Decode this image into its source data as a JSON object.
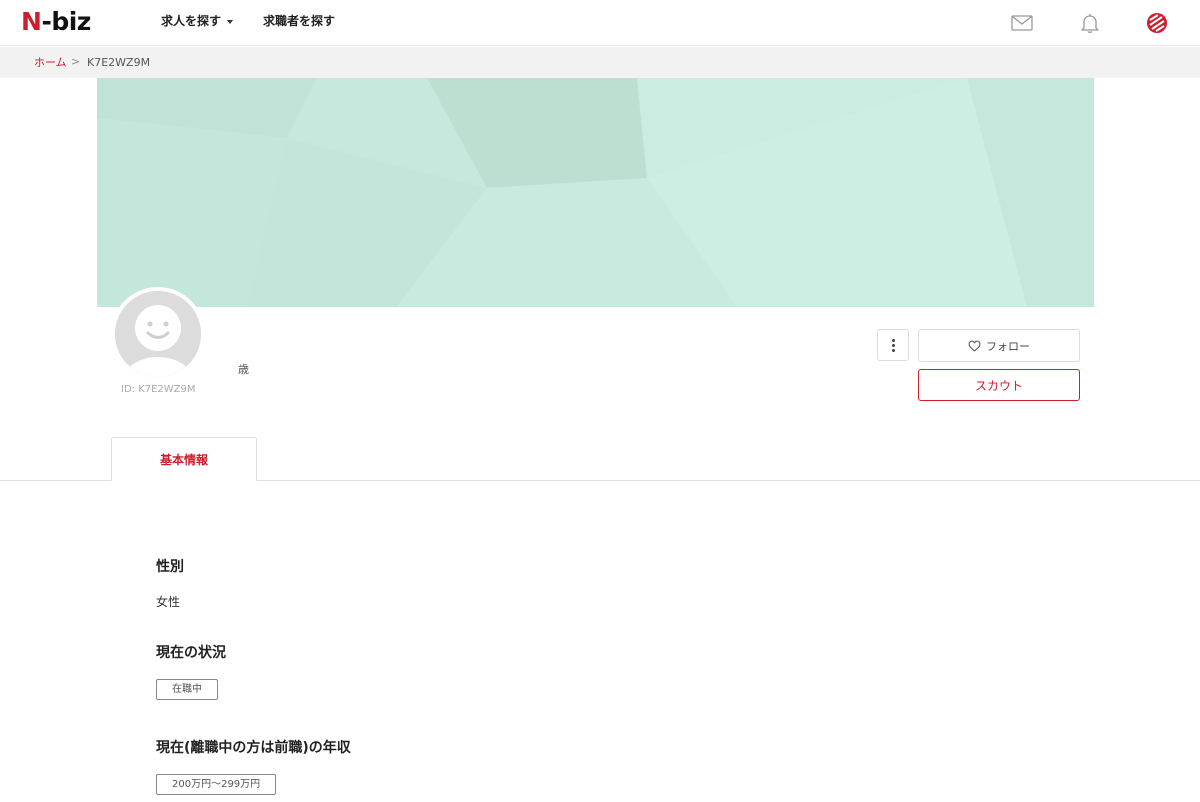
{
  "header": {
    "logo_n": "N",
    "logo_rest": "-biz",
    "nav": [
      {
        "label": "求人を探す"
      },
      {
        "label": "求職者を探す"
      }
    ],
    "icons": [
      "mail-icon",
      "bell-icon",
      "brand-mark-icon"
    ],
    "brand_color": "#cc1e2c"
  },
  "breadcrumb": {
    "home": "ホーム",
    "separator": ">",
    "current": "K7E2WZ9M"
  },
  "profile": {
    "id_text": "ID: K7E2WZ9M",
    "age_text": "歳",
    "cover_color": "#c6e9dd"
  },
  "actions": {
    "follow_label": "フォロー",
    "scout_label": "スカウト"
  },
  "tabs": [
    {
      "label": "基本情報",
      "active": true
    }
  ],
  "fields": {
    "gender": {
      "label": "性別",
      "value": "女性"
    },
    "status": {
      "label": "現在の状況",
      "value": "在職中"
    },
    "income": {
      "label": "現在(離職中の方は前職)の年収",
      "value": "200万円〜299万円"
    }
  }
}
